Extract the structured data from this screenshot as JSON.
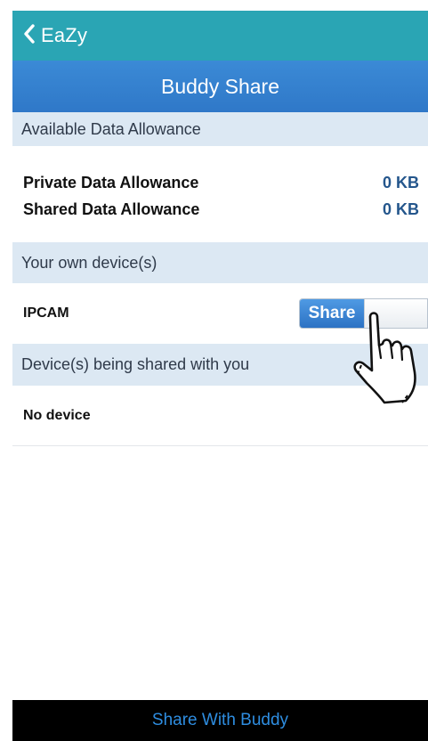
{
  "nav": {
    "back_label": "EaZy",
    "title": "Buddy Share"
  },
  "allowance": {
    "header": "Available Data Allowance",
    "rows": [
      {
        "label": "Private Data Allowance",
        "value": "0 KB"
      },
      {
        "label": "Shared Data Allowance",
        "value": "0 KB"
      }
    ]
  },
  "own_devices": {
    "header": "Your own device(s)",
    "items": [
      {
        "name": "IPCAM",
        "toggle_label": "Share",
        "shared": true
      }
    ]
  },
  "shared_devices": {
    "header": "Device(s) being shared with you",
    "empty_text": "No device"
  },
  "footer": {
    "button_label": "Share With Buddy"
  },
  "colors": {
    "topbar": "#2aa5b4",
    "titlebar": "#3582cf",
    "section_header_bg": "#dce8f3",
    "value_text": "#24568c",
    "footer_bg": "#000000",
    "footer_text": "#2e8de0"
  },
  "icons": {
    "back": "chevron-left-icon",
    "pointer": "pointing-hand-icon"
  }
}
